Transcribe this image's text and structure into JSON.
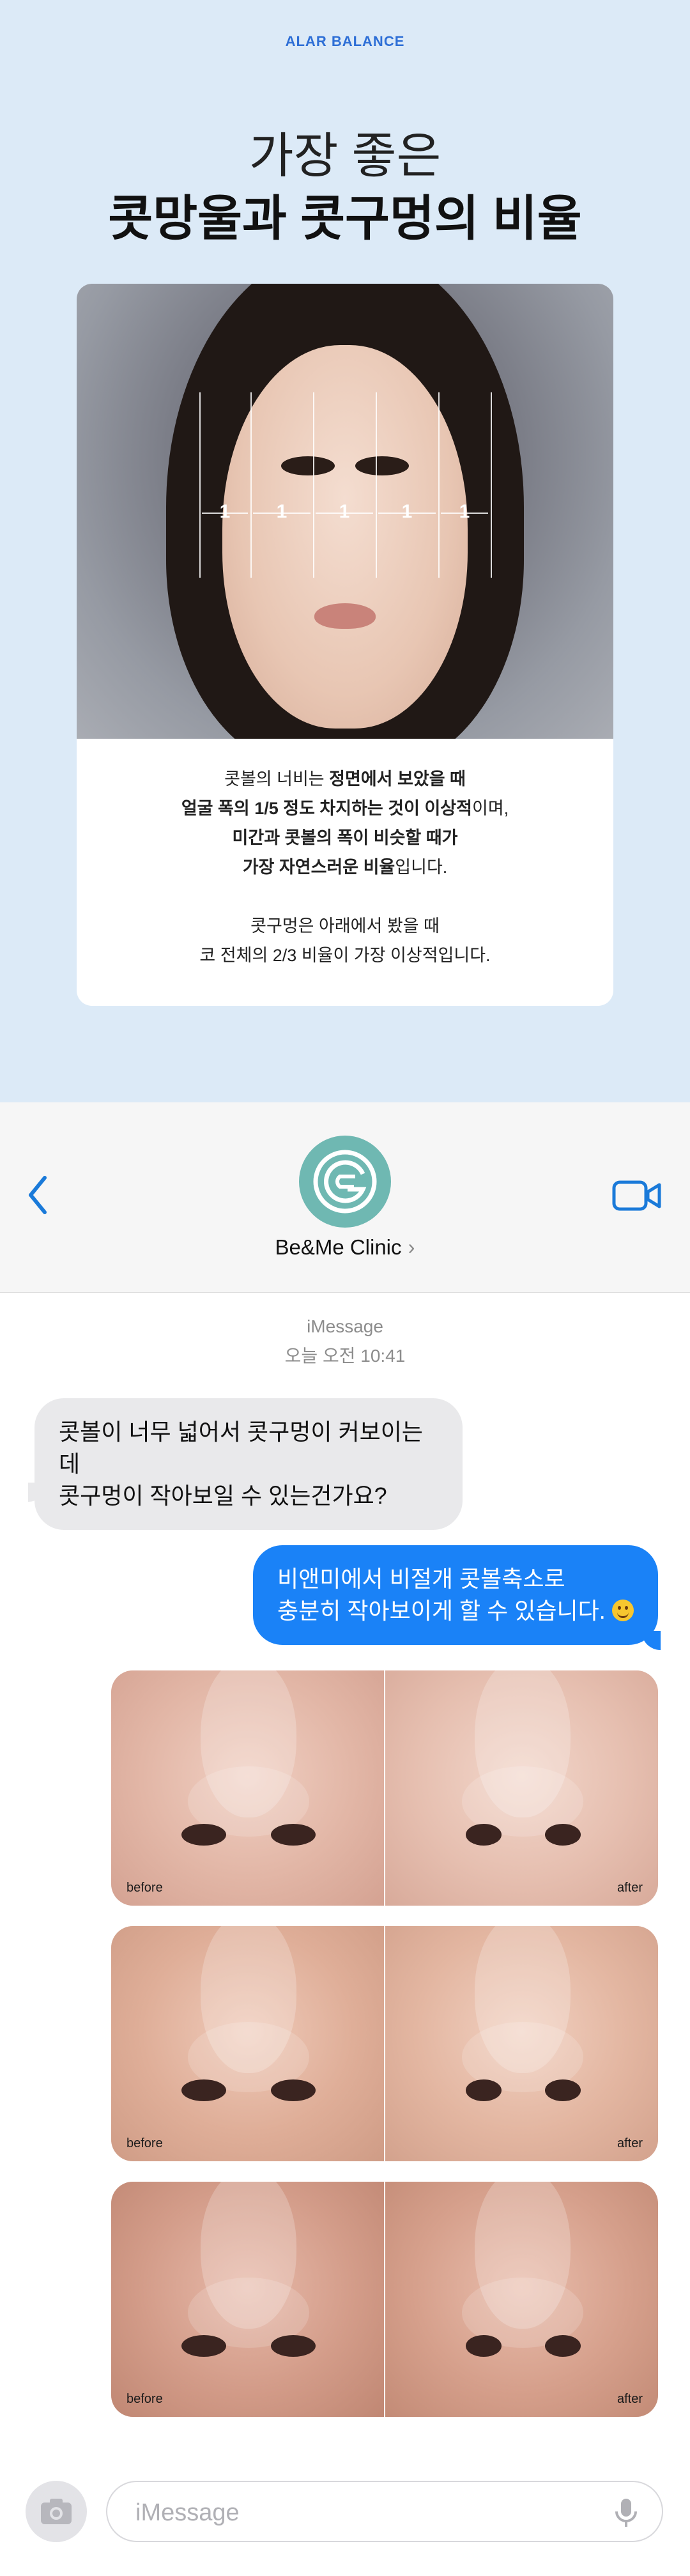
{
  "info": {
    "eyebrow": "ALAR BALANCE",
    "headline_line1": "가장 좋은",
    "headline_line2": "콧망울과 콧구멍의 비율",
    "ratio_marks": [
      "1",
      "1",
      "1",
      "1",
      "1"
    ],
    "desc": [
      [
        {
          "t": "콧볼의 너비는 ",
          "b": false
        },
        {
          "t": "정면에서 보았을 때",
          "b": true
        }
      ],
      [
        {
          "t": "얼굴 폭의 1/5 정도 차지하는 것이 이상적",
          "b": true
        },
        {
          "t": "이며,",
          "b": false
        }
      ],
      [
        {
          "t": "미간과 콧볼의 폭이 비슷할 때가",
          "b": true
        }
      ],
      [
        {
          "t": "가장 자연스러운 비율",
          "b": true
        },
        {
          "t": "입니다.",
          "b": false
        }
      ],
      [],
      [
        {
          "t": "콧구멍은 아래에서 봤을 때",
          "b": false
        }
      ],
      [
        {
          "t": "코 전체의 2/3 비율이 가장 이상적입니다.",
          "b": false
        }
      ]
    ]
  },
  "header": {
    "contact_name": "Be&Me Clinic",
    "chevron": "›",
    "back_icon": "chevron-left-icon",
    "video_icon": "video-camera-icon",
    "accent_color": "#1a7ad9"
  },
  "thread": {
    "service_label": "iMessage",
    "timestamp": "오늘 오전 10:41",
    "incoming": {
      "line1": "콧볼이 너무 넓어서 콧구멍이 커보이는데",
      "line2": "콧구멍이 작아보일 수 있는건가요?"
    },
    "outgoing": {
      "line1": "비앤미에서 비절개 콧볼축소로",
      "line2": "충분히 작아보이게 할 수 있습니다."
    },
    "photos": [
      {
        "before": "before",
        "after": "after"
      },
      {
        "before": "before",
        "after": "after"
      },
      {
        "before": "before",
        "after": "after"
      }
    ]
  },
  "composer": {
    "placeholder": "iMessage",
    "camera_icon": "camera-icon",
    "mic_icon": "microphone-icon"
  }
}
